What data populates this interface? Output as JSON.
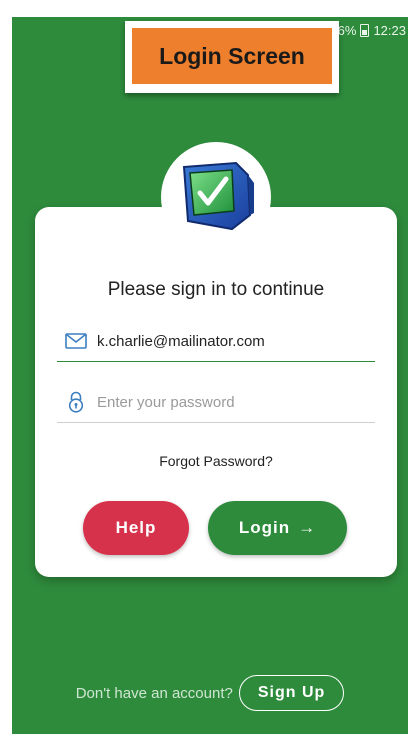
{
  "banner": {
    "title": "Login Screen"
  },
  "status_bar": {
    "battery": "26%",
    "time": "12:23"
  },
  "card": {
    "heading": "Please sign in to continue",
    "email": {
      "value": "k.charlie@mailinator.com",
      "icon": "mail-icon"
    },
    "password": {
      "placeholder": "Enter your password",
      "icon": "lock-icon"
    },
    "forgot_label": "Forgot Password?",
    "help_label": "Help",
    "login_label": "Login",
    "login_arrow": "→"
  },
  "footer": {
    "prompt": "Don't have an account?",
    "signup_label": "Sign Up"
  },
  "colors": {
    "background": "#2e8b3c",
    "help_button": "#d7324c",
    "login_button": "#2e8b3c",
    "banner": "#ee7f2c"
  }
}
